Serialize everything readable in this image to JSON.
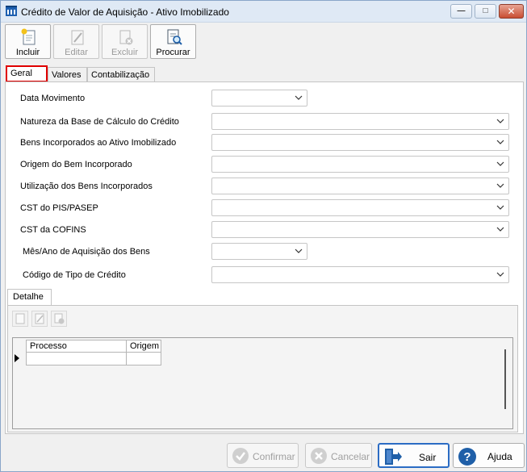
{
  "window": {
    "title": "Crédito de Valor de Aquisição - Ativo Imobilizado",
    "close_glyph": "✕",
    "maximize_glyph": "□",
    "minimize_glyph": "—"
  },
  "toolbar": {
    "incluir": "Incluir",
    "editar": "Editar",
    "excluir": "Excluir",
    "procurar": "Procurar"
  },
  "tabs": {
    "geral": "Geral",
    "valores": "Valores",
    "contabilizacao": "Contabilização"
  },
  "fields": [
    {
      "label": "Data Movimento",
      "value": ""
    },
    {
      "label": "Natureza da Base de Cálculo do Crédito",
      "value": ""
    },
    {
      "label": "Bens Incorporados ao Ativo Imobilizado",
      "value": ""
    },
    {
      "label": "Origem do Bem Incorporado",
      "value": ""
    },
    {
      "label": "Utilização dos Bens Incorporados",
      "value": ""
    },
    {
      "label": "CST do PIS/PASEP",
      "value": ""
    },
    {
      "label": "CST da COFINS",
      "value": ""
    },
    {
      "label": "Mês/Ano de Aquisição dos Bens",
      "value": ""
    },
    {
      "label": "Código de Tipo de Crédito",
      "value": ""
    }
  ],
  "detalhe": {
    "tab_label": "Detalhe",
    "columns": [
      "Processo",
      "Origem"
    ],
    "rows": [
      [
        "",
        ""
      ]
    ]
  },
  "buttons": {
    "confirmar": "Confirmar",
    "cancelar": "Cancelar",
    "sair": "Sair",
    "ajuda": "Ajuda"
  },
  "colors": {
    "active_tab_border": "#e00000",
    "focus_border": "#2b6cc4"
  }
}
